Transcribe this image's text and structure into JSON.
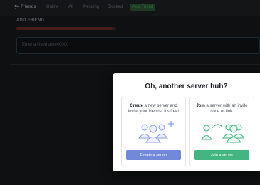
{
  "topbar": {
    "tabs": [
      {
        "label": "Friends"
      },
      {
        "label": "Online"
      },
      {
        "label": "All"
      },
      {
        "label": "Pending"
      },
      {
        "label": "Blocked"
      },
      {
        "label": "Add Friend"
      }
    ]
  },
  "add_friend": {
    "heading": "ADD FRIEND",
    "input_placeholder": "Enter a Username#0000"
  },
  "modal": {
    "title": "Oh, another server huh?",
    "create": {
      "desc_strong": "Create",
      "desc_rest": " a new server and invite your friends. It's free!",
      "button": "Create a server"
    },
    "join": {
      "desc_strong": "Join",
      "desc_rest": " a server with an invite code or link.",
      "button": "Join a server"
    }
  },
  "colors": {
    "blurple": "#7289da",
    "green": "#43b581",
    "modal_bg": "#ffffff"
  }
}
